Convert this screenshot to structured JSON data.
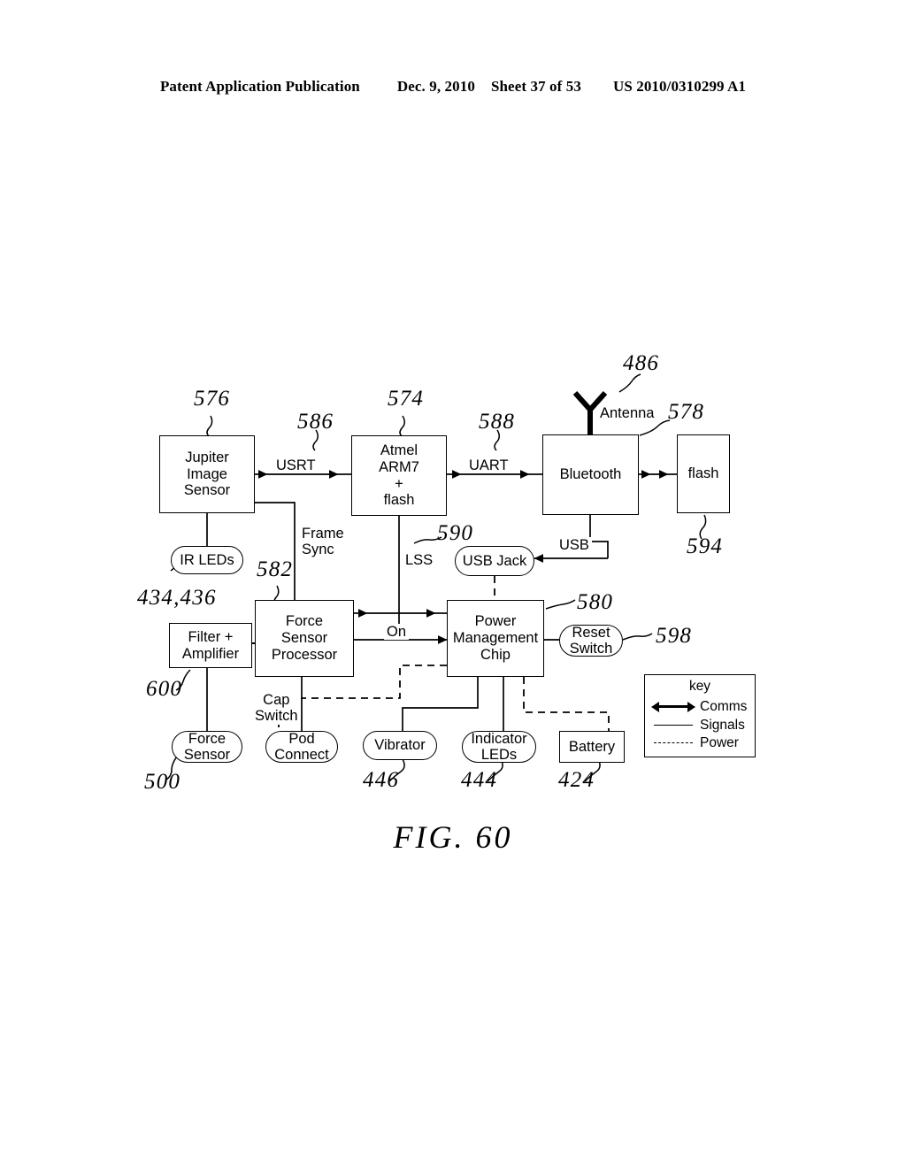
{
  "header": {
    "publication": "Patent Application Publication",
    "date": "Dec. 9, 2010",
    "sheet": "Sheet 37 of 53",
    "patent_number": "US 2010/0310299 A1"
  },
  "figure": {
    "caption": "FIG. 60",
    "blocks": [
      {
        "id": "jupiter",
        "label": "Jupiter\nImage\nSensor",
        "ref": "576"
      },
      {
        "id": "atmel",
        "label": "Atmel\nARM7\n+\nflash",
        "ref": "574"
      },
      {
        "id": "bluetooth",
        "label": "Bluetooth",
        "ref": "578"
      },
      {
        "id": "flash",
        "label": "flash",
        "ref": "594"
      },
      {
        "id": "filteramp",
        "label": "Filter +\nAmplifier",
        "ref": "600"
      },
      {
        "id": "fsp",
        "label": "Force\nSensor\nProcessor",
        "ref": "582"
      },
      {
        "id": "pmc",
        "label": "Power\nManagement\nChip",
        "ref": "580"
      },
      {
        "id": "battery",
        "label": "Battery",
        "ref": "424"
      }
    ],
    "pills": [
      {
        "id": "irleds",
        "label": "IR LEDs",
        "ref": "434,436"
      },
      {
        "id": "usbjack",
        "label": "USB Jack",
        "ref": ""
      },
      {
        "id": "resetsw",
        "label": "Reset\nSwitch",
        "ref": "598"
      },
      {
        "id": "forcesens",
        "label": "Force\nSensor",
        "ref": "500"
      },
      {
        "id": "podconn",
        "label": "Pod\nConnect",
        "ref": ""
      },
      {
        "id": "vibrator",
        "label": "Vibrator",
        "ref": "446"
      },
      {
        "id": "indleds",
        "label": "Indicator\nLEDs",
        "ref": "444"
      }
    ],
    "connection_labels": {
      "usrt": "USRT",
      "uart": "UART",
      "usb": "USB",
      "lss": "LSS",
      "on": "On",
      "frame_sync": "Frame\nSync",
      "cap_switch": "Cap\nSwitch",
      "antenna": "Antenna"
    },
    "connection_refs": {
      "usrt": "586",
      "uart": "588",
      "lss": "590",
      "antenna": "486"
    },
    "key": {
      "title": "key",
      "items": [
        {
          "style": "comms",
          "label": "Comms"
        },
        {
          "style": "signals",
          "label": "Signals"
        },
        {
          "style": "power",
          "label": "Power"
        }
      ]
    }
  }
}
